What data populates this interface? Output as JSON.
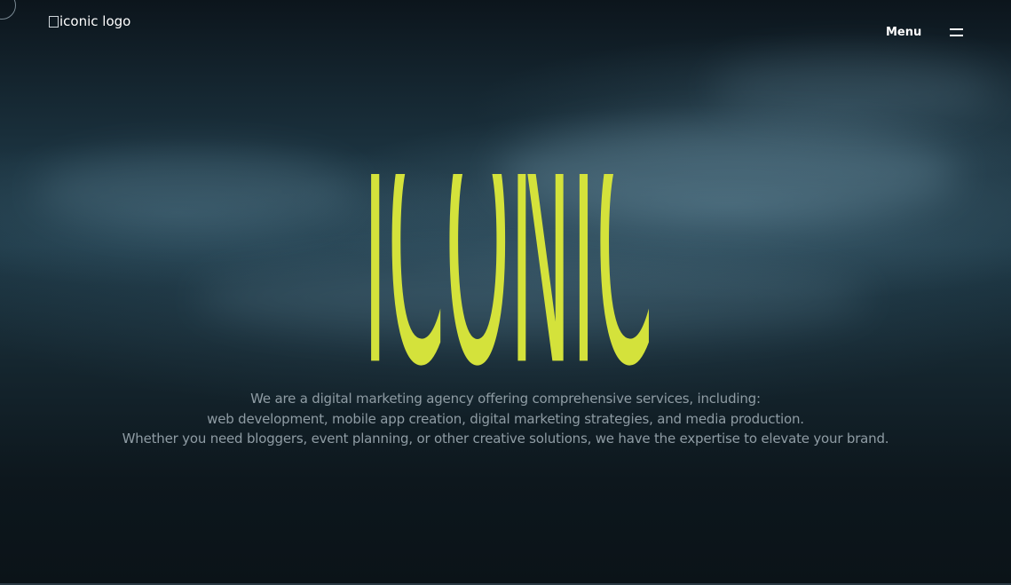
{
  "header": {
    "logo_alt": "iconic logo",
    "menu_label": "Menu",
    "menu_icon": "hamburger-icon"
  },
  "hero": {
    "title": "ICONIC",
    "title_color": "#d4e23b",
    "tagline_lines": [
      "We are a digital marketing agency offering comprehensive services, including:",
      "web development, mobile app creation, digital marketing strategies, and media production.",
      "Whether you need bloggers, event planning, or other creative solutions, we have the expertise to elevate your brand."
    ]
  },
  "colors": {
    "background": "#1c3441",
    "text_muted": "#8f9ca4",
    "accent": "#d4e23b"
  }
}
